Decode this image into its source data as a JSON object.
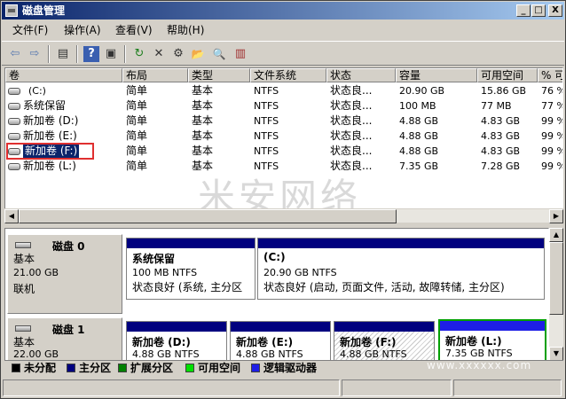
{
  "window": {
    "title": "磁盘管理",
    "minimize": "_",
    "maximize": "□",
    "close": "X"
  },
  "menu": [
    "文件(F)",
    "操作(A)",
    "查看(V)",
    "帮助(H)"
  ],
  "toolbar": [
    {
      "icon": "back-arrow-icon",
      "glyph": "⇦"
    },
    {
      "icon": "forward-arrow-icon",
      "glyph": "⇨"
    },
    {
      "icon": "console-tree-icon",
      "glyph": "▤"
    },
    {
      "icon": "help-icon",
      "glyph": "?"
    },
    {
      "icon": "properties-icon",
      "glyph": "▣"
    },
    {
      "icon": "refresh-icon",
      "glyph": "↻"
    },
    {
      "icon": "delete-icon",
      "glyph": "✕"
    },
    {
      "icon": "settings-icon",
      "glyph": "⚙"
    },
    {
      "icon": "open-folder-icon",
      "glyph": "📂"
    },
    {
      "icon": "search-icon",
      "glyph": "🔍"
    },
    {
      "icon": "export-icon",
      "glyph": "▥"
    }
  ],
  "columns": [
    "卷",
    "布局",
    "类型",
    "文件系统",
    "状态",
    "容量",
    "可用空间",
    "% 可"
  ],
  "volumes": [
    {
      "name": "(C:)",
      "layout": "简单",
      "type": "基本",
      "fs": "NTFS",
      "status": "状态良...",
      "capacity": "20.90 GB",
      "free": "15.86 GB",
      "pct": "76 %"
    },
    {
      "name": "系统保留",
      "layout": "简单",
      "type": "基本",
      "fs": "NTFS",
      "status": "状态良...",
      "capacity": "100 MB",
      "free": "77 MB",
      "pct": "77 %"
    },
    {
      "name": "新加卷 (D:)",
      "layout": "简单",
      "type": "基本",
      "fs": "NTFS",
      "status": "状态良...",
      "capacity": "4.88 GB",
      "free": "4.83 GB",
      "pct": "99 %"
    },
    {
      "name": "新加卷 (E:)",
      "layout": "简单",
      "type": "基本",
      "fs": "NTFS",
      "status": "状态良...",
      "capacity": "4.88 GB",
      "free": "4.83 GB",
      "pct": "99 %"
    },
    {
      "name": "新加卷 (F:)",
      "layout": "简单",
      "type": "基本",
      "fs": "NTFS",
      "status": "状态良...",
      "capacity": "4.88 GB",
      "free": "4.83 GB",
      "pct": "99 %"
    },
    {
      "name": "新加卷 (L:)",
      "layout": "简单",
      "type": "基本",
      "fs": "NTFS",
      "status": "状态良...",
      "capacity": "7.35 GB",
      "free": "7.28 GB",
      "pct": "99 %"
    }
  ],
  "watermark": "米安网络",
  "disks": [
    {
      "name": "磁盘 0",
      "kind": "基本",
      "size": "21.00 GB",
      "state": "联机",
      "partitions": [
        {
          "name": "系统保留",
          "size": "100 MB NTFS",
          "status": "状态良好 (系统, 主分区"
        },
        {
          "name": "(C:)",
          "size": "20.90 GB NTFS",
          "status": "状态良好 (启动, 页面文件, 活动, 故障转储, 主分区)"
        }
      ]
    },
    {
      "name": "磁盘 1",
      "kind": "基本",
      "size": "22.00 GB",
      "partitions": [
        {
          "name": "新加卷 (D:)",
          "size": "4.88 GB NTFS"
        },
        {
          "name": "新加卷 (E:)",
          "size": "4.88 GB NTFS"
        },
        {
          "name": "新加卷 (F:)",
          "size": "4.88 GB NTFS"
        },
        {
          "name": "新加卷 (L:)",
          "size": "7.35 GB NTFS"
        }
      ]
    }
  ],
  "legend": [
    {
      "label": "未分配",
      "color": "#000000"
    },
    {
      "label": "主分区",
      "color": "#00007f"
    },
    {
      "label": "扩展分区",
      "color": "#008000"
    },
    {
      "label": "可用空间",
      "color": "#00e000"
    },
    {
      "label": "逻辑驱动器",
      "color": "#1e1ee6"
    }
  ],
  "credit": "www.xxxxxx.com"
}
